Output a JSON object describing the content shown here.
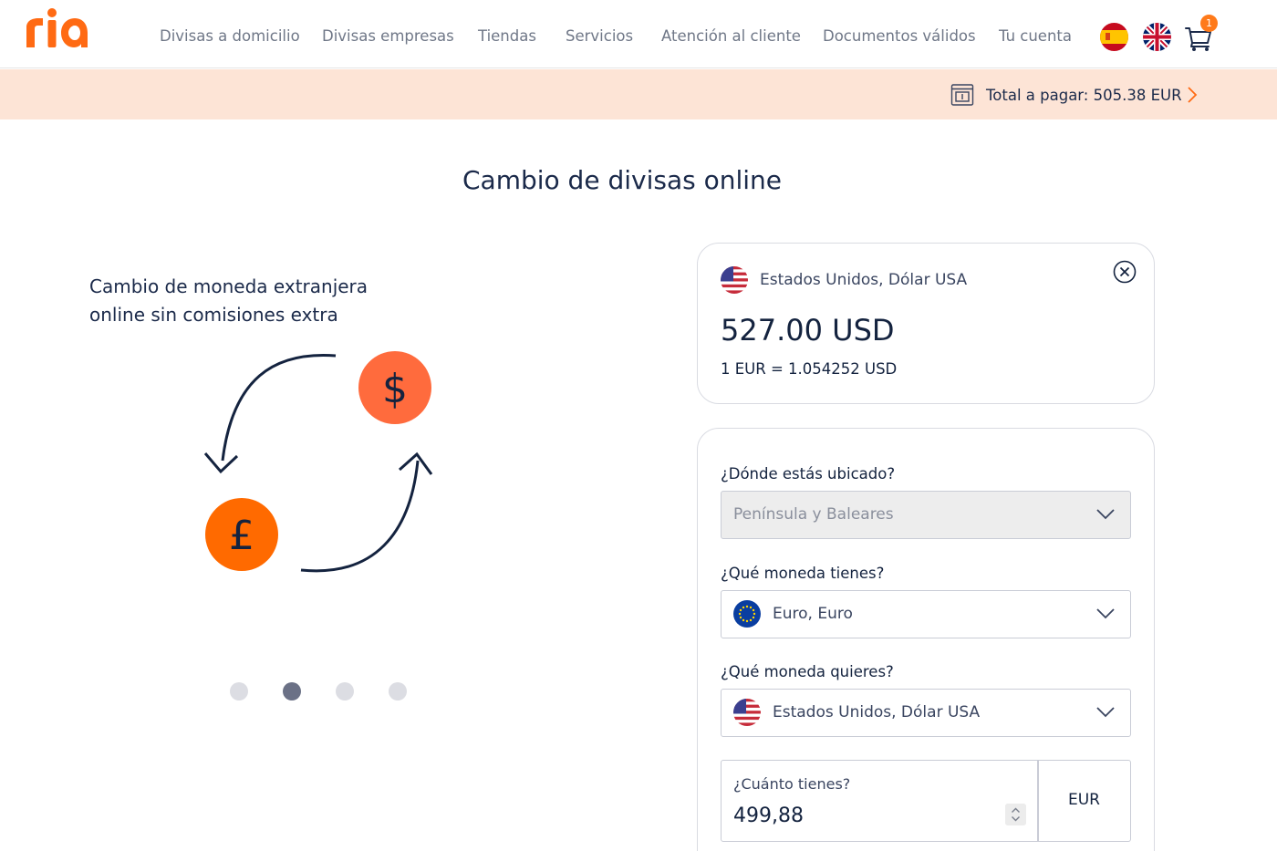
{
  "header": {
    "logo_text": "ria",
    "nav": [
      {
        "label": "Divisas a domicilio"
      },
      {
        "label": "Divisas empresas"
      },
      {
        "label": "Tiendas"
      },
      {
        "label": "Servicios"
      },
      {
        "label": "Atención al cliente"
      },
      {
        "label": "Documentos válidos"
      },
      {
        "label": "Tu cuenta"
      }
    ],
    "cart_count": "1"
  },
  "paybar": {
    "label": "Total a pagar:",
    "amount": "505.38 EUR"
  },
  "page_title": "Cambio de divisas online",
  "hero": {
    "line1": "Cambio de moneda extranjera",
    "line2": "online sin comisiones extra",
    "slides_total": 4,
    "active_slide": 2
  },
  "summary": {
    "country": "Estados Unidos, Dólar USA",
    "amount": "527.00 USD",
    "rate": "1 EUR = 1.054252 USD"
  },
  "form": {
    "location_label": "¿Dónde estás ubicado?",
    "location_value": "Península y Baleares",
    "have_label": "¿Qué moneda tienes?",
    "have_value": "Euro, Euro",
    "want_label": "¿Qué moneda quieres?",
    "want_value": "Estados Unidos, Dólar USA",
    "amount_label": "¿Cuánto tienes?",
    "amount_value": "499,88",
    "amount_currency": "EUR"
  },
  "colors": {
    "brand_orange": "#ff6a13",
    "paybar_bg": "#fde4d6",
    "text_dark": "#14233f"
  }
}
